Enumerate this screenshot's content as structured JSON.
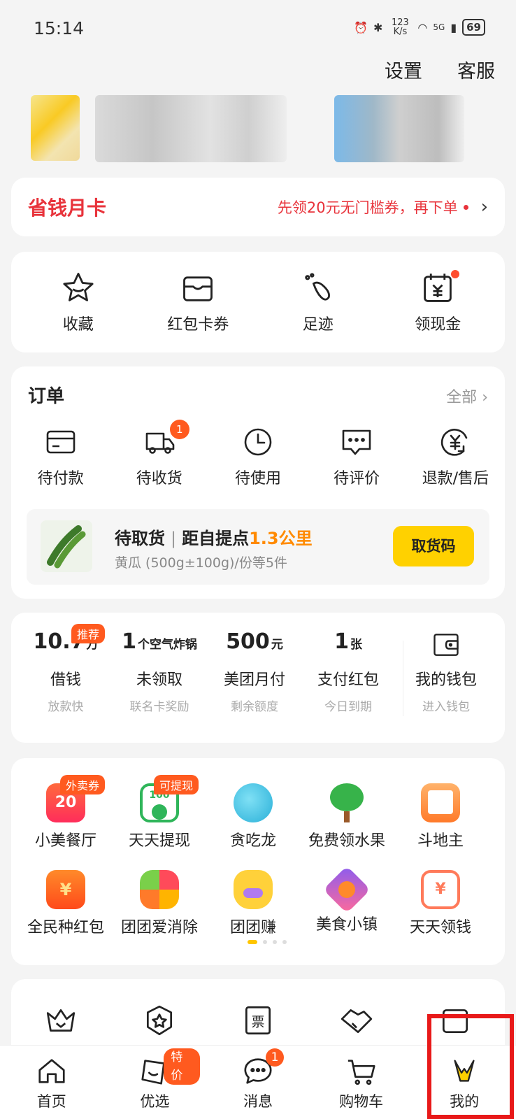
{
  "status_bar": {
    "time": "15:14",
    "net_speed": "123 K/s",
    "network": "5G",
    "battery": "69"
  },
  "header": {
    "settings": "设置",
    "service": "客服"
  },
  "vip_card": {
    "title": "省钱月卡",
    "desc": "先领20元无门槛券，再下单"
  },
  "quick": [
    {
      "label": "收藏",
      "icon": "star-icon"
    },
    {
      "label": "红包卡券",
      "icon": "wallet-card-icon"
    },
    {
      "label": "足迹",
      "icon": "footprint-icon"
    },
    {
      "label": "领现金",
      "icon": "calendar-cash-icon"
    }
  ],
  "orders": {
    "title": "订单",
    "all": "全部",
    "items": [
      {
        "label": "待付款",
        "icon": "card-icon"
      },
      {
        "label": "待收货",
        "icon": "truck-icon",
        "badge": "1"
      },
      {
        "label": "待使用",
        "icon": "clock-icon"
      },
      {
        "label": "待评价",
        "icon": "comment-icon"
      },
      {
        "label": "退款/售后",
        "icon": "refund-icon"
      }
    ],
    "pickup": {
      "status": "待取货",
      "dist_label": "距自提点",
      "distance": "1.3公里",
      "item": "黄瓜 (500g±100g)/份等5件",
      "button": "取货码"
    }
  },
  "wallet": [
    {
      "value": "10.7",
      "unit": "万",
      "label": "借钱",
      "sub": "放款快",
      "tag": "推荐"
    },
    {
      "value": "1",
      "unit": "个空气炸锅",
      "label": "未领取",
      "sub": "联名卡奖励"
    },
    {
      "value": "500",
      "unit": "元",
      "label": "美团月付",
      "sub": "剩余额度"
    },
    {
      "value": "1",
      "unit": "张",
      "label": "支付红包",
      "sub": "今日到期"
    },
    {
      "label": "我的钱包",
      "sub": "进入钱包",
      "icon": "wallet-icon"
    }
  ],
  "games": [
    {
      "label": "小美餐厅",
      "tag": "外卖券",
      "color": "#ff3b4b",
      "icon": "coupon-20-icon",
      "icon_text": "20"
    },
    {
      "label": "天天提现",
      "tag": "可提现",
      "color": "#2fb55a",
      "icon": "cash-100-icon",
      "icon_text": "100"
    },
    {
      "label": "贪吃龙",
      "color": "#3ec7e8",
      "icon": "dragon-icon"
    },
    {
      "label": "免费领水果",
      "color": "#37b34a",
      "icon": "tree-icon"
    },
    {
      "label": "斗地主",
      "color": "#ff8a3c",
      "icon": "cards-icon"
    },
    {
      "label": "全民种红包",
      "color": "#ff6a1a",
      "icon": "red-envelope-icon"
    },
    {
      "label": "团团爱消除",
      "color": "#ffb400",
      "icon": "match-icon"
    },
    {
      "label": "团团赚",
      "color": "#ffd13a",
      "icon": "rabbit-icon"
    },
    {
      "label": "美食小镇",
      "color": "#8a5cf0",
      "icon": "fox-icon"
    },
    {
      "label": "天天领钱",
      "color": "#ff7a5a",
      "icon": "calendar-money-icon"
    }
  ],
  "more_icons": [
    "crown-icon",
    "badge-star-icon",
    "ticket-icon",
    "handshake-icon",
    "box-icon"
  ],
  "more_ticket_text": "票",
  "tabs": [
    {
      "label": "首页",
      "icon": "home-icon"
    },
    {
      "label": "优选",
      "icon": "smile-bag-icon",
      "badge": "特价"
    },
    {
      "label": "消息",
      "icon": "message-icon",
      "badge": "1"
    },
    {
      "label": "购物车",
      "icon": "cart-icon"
    },
    {
      "label": "我的",
      "icon": "my-mascot-icon",
      "active": true
    }
  ]
}
